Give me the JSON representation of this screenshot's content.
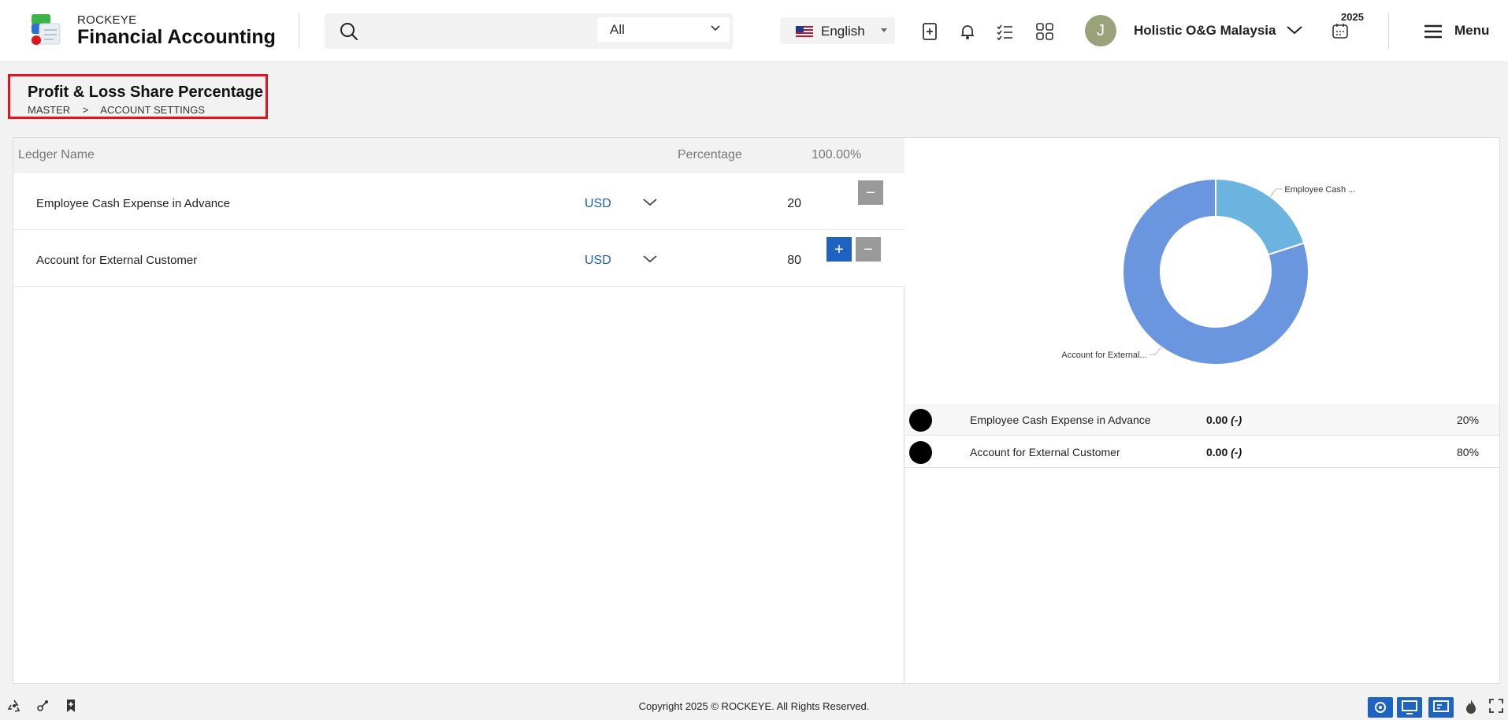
{
  "header": {
    "brand_top": "ROCKEYE",
    "brand_main": "Financial Accounting",
    "search": {
      "placeholder": "",
      "scope": "All"
    },
    "language": "English",
    "avatar_initial": "J",
    "company": "Holistic O&G Malaysia",
    "year": "2025",
    "menu_label": "Menu"
  },
  "page": {
    "title": "Profit & Loss Share Percentage",
    "breadcrumb": [
      "MASTER",
      ">",
      "ACCOUNT SETTINGS"
    ]
  },
  "table": {
    "col_ledger": "Ledger Name",
    "col_percentage": "Percentage",
    "total_percentage": "100.00%",
    "rows": [
      {
        "ledger": "Employee Cash Expense in Advance",
        "currency": "USD",
        "percentage": "20"
      },
      {
        "ledger": "Account for External Customer",
        "currency": "USD",
        "percentage": "80"
      }
    ]
  },
  "chart_data": {
    "type": "pie",
    "categories": [
      "Employee Cash Expense in Advance",
      "Account for External Customer"
    ],
    "values": [
      20,
      80
    ],
    "slice_labels": [
      "Employee Cash ...",
      "Account for External..."
    ],
    "colors": [
      "#6ab4df",
      "#6a96e0"
    ],
    "hole": true
  },
  "legend": [
    {
      "name": "Employee Cash Expense in Advance",
      "amount": "0.00",
      "amount_suffix": "(-)",
      "percent": "20%"
    },
    {
      "name": "Account for External Customer",
      "amount": "0.00",
      "amount_suffix": "(-)",
      "percent": "80%"
    }
  ],
  "footer": {
    "copyright": "Copyright 2025 © ROCKEYE. All Rights Reserved."
  },
  "colors": {
    "accent": "#1e63c2",
    "highlight_border": "#e3141c",
    "currency_text": "#1e5fb4"
  }
}
